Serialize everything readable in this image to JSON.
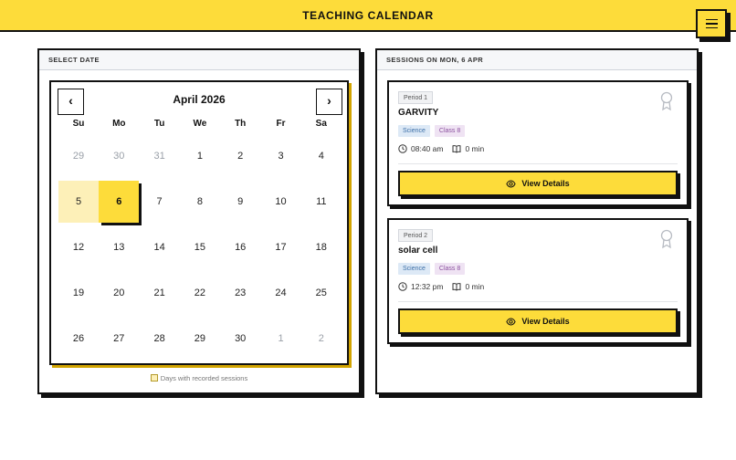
{
  "header": {
    "title": "TEACHING CALENDAR",
    "menu_icon": "hamburger-menu-icon"
  },
  "date_panel": {
    "title": "SELECT DATE",
    "month": "April 2026",
    "prev_label": "‹",
    "next_label": "›",
    "weekdays": [
      "Su",
      "Mo",
      "Tu",
      "We",
      "Th",
      "Fr",
      "Sa"
    ],
    "weeks": [
      [
        {
          "label": "29",
          "muted": true
        },
        {
          "label": "30",
          "muted": true
        },
        {
          "label": "31",
          "muted": true
        },
        {
          "label": "1"
        },
        {
          "label": "2"
        },
        {
          "label": "3"
        },
        {
          "label": "4"
        }
      ],
      [
        {
          "label": "5",
          "recorded": true
        },
        {
          "label": "6",
          "recorded": true,
          "selected": true
        },
        {
          "label": "7"
        },
        {
          "label": "8"
        },
        {
          "label": "9"
        },
        {
          "label": "10"
        },
        {
          "label": "11"
        }
      ],
      [
        {
          "label": "12"
        },
        {
          "label": "13"
        },
        {
          "label": "14"
        },
        {
          "label": "15"
        },
        {
          "label": "16"
        },
        {
          "label": "17"
        },
        {
          "label": "18"
        }
      ],
      [
        {
          "label": "19"
        },
        {
          "label": "20"
        },
        {
          "label": "21"
        },
        {
          "label": "22"
        },
        {
          "label": "23"
        },
        {
          "label": "24"
        },
        {
          "label": "25"
        }
      ],
      [
        {
          "label": "26"
        },
        {
          "label": "27"
        },
        {
          "label": "28"
        },
        {
          "label": "29"
        },
        {
          "label": "30"
        },
        {
          "label": "1",
          "muted": true
        },
        {
          "label": "2",
          "muted": true
        }
      ]
    ],
    "legend": "Days with recorded sessions"
  },
  "sessions_panel": {
    "title": "SESSIONS ON MON, 6 APR",
    "sessions": [
      {
        "period": "Period 1",
        "title": "GARVITY",
        "subject": "Science",
        "class": "Class 8",
        "time": "08:40 am",
        "duration": "0 min",
        "button": "View Details"
      },
      {
        "period": "Period 2",
        "title": "solar cell",
        "subject": "Science",
        "class": "Class 8",
        "time": "12:32 pm",
        "duration": "0 min",
        "button": "View Details"
      }
    ]
  },
  "colors": {
    "accent": "#fddc3a",
    "recorded": "#fdf0b8",
    "ink": "#111111"
  }
}
